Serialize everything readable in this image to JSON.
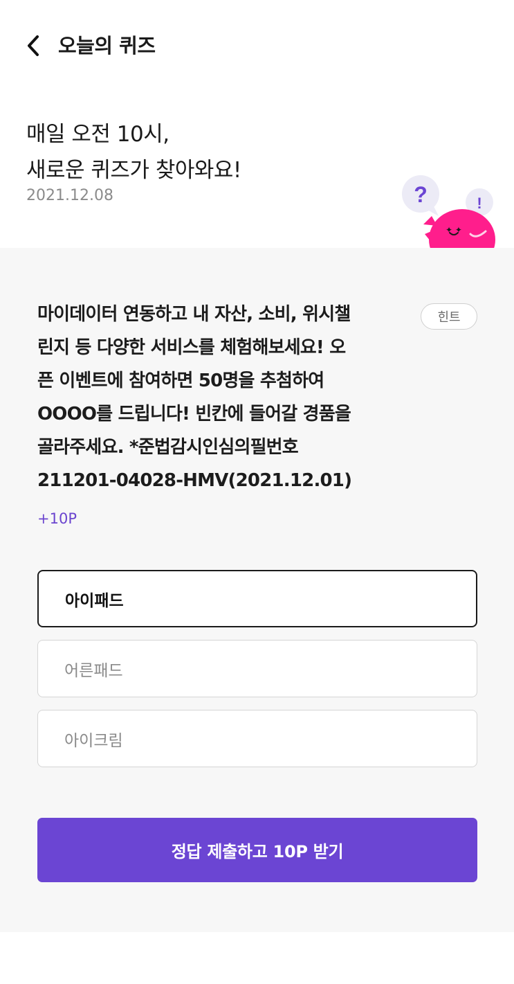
{
  "header": {
    "title": "오늘의 퀴즈"
  },
  "intro": {
    "headline_line1": "매일 오전 10시,",
    "headline_line2": "새로운 퀴즈가 찾아와요!",
    "date": "2021.12.08",
    "mascot": {
      "question_mark": "?",
      "exclamation_mark": "!"
    }
  },
  "quiz": {
    "question_lines": [
      "마이데이터 연동하고 내 자산, 소비, 위시챌",
      "린지 등 다양한 서비스를 체험해보세요! 오",
      "픈 이벤트에 참여하면 50명을 추첨하여",
      "OOOO를 드립니다! 빈칸에 들어갈 경품을",
      "골라주세요. *준법감시인심의필번호",
      "211201-04028-HMV(2021.12.01)"
    ],
    "hint_label": "힌트",
    "reward": "+10P",
    "options": [
      {
        "label": "아이패드",
        "selected": true
      },
      {
        "label": "어른패드",
        "selected": false
      },
      {
        "label": "아이크림",
        "selected": false
      }
    ],
    "submit_label": "정답 제출하고 10P 받기"
  },
  "colors": {
    "accent": "#6b45d3",
    "reward_text": "#6b45cf",
    "mascot": "#ff1e8c",
    "panel_bg": "#f7f7f7"
  },
  "icons": {
    "back": "chevron-left-icon"
  }
}
